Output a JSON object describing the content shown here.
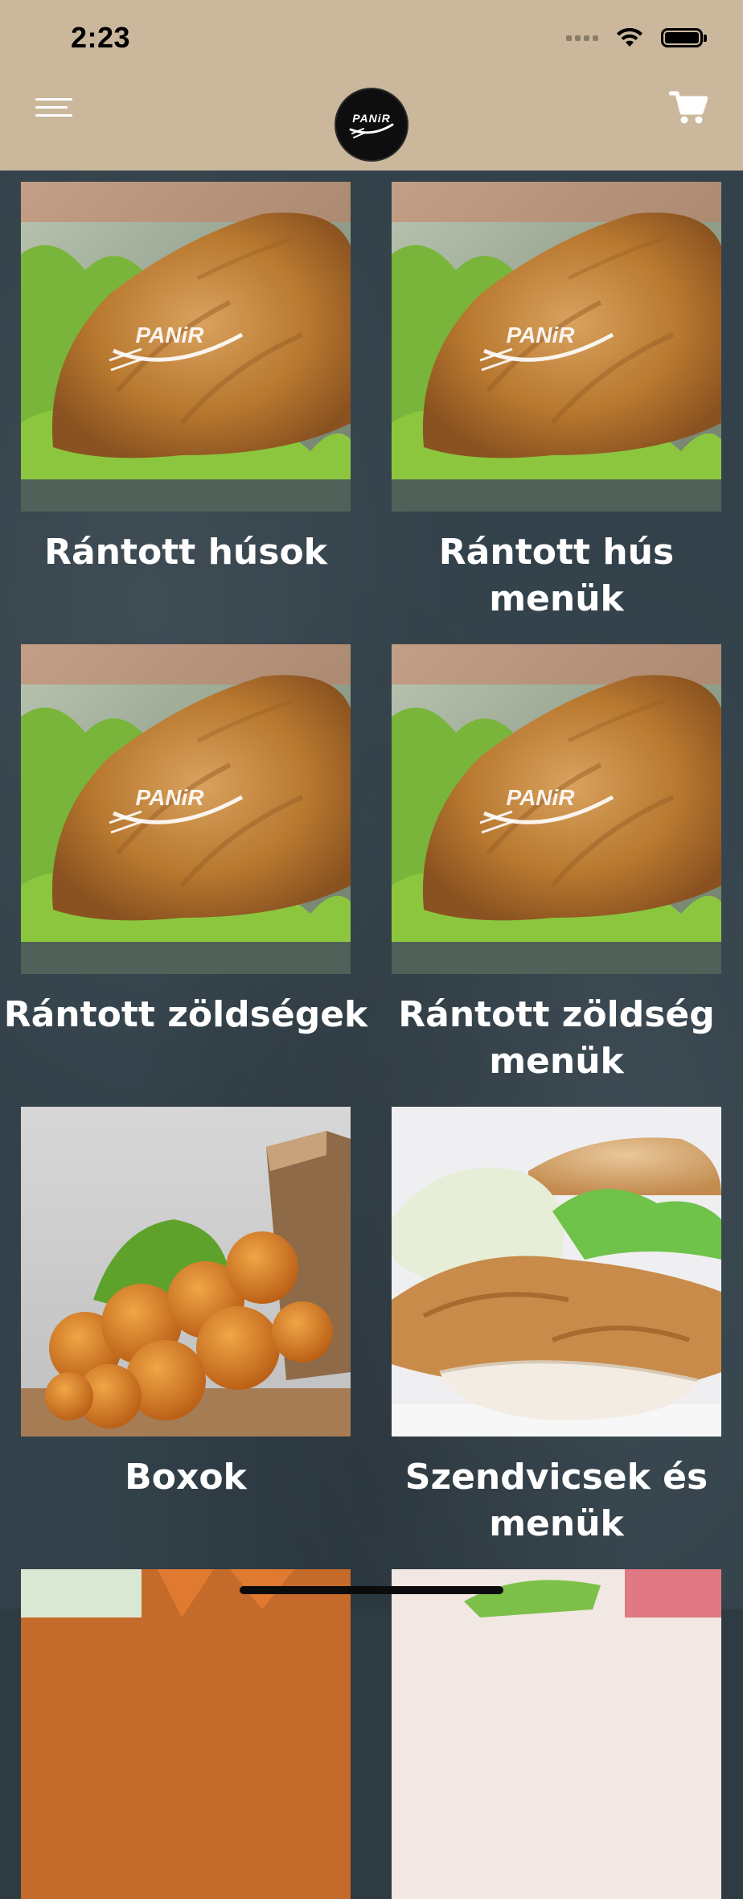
{
  "status_bar": {
    "time": "2:23"
  },
  "header": {
    "menu_icon": "hamburger-menu-icon",
    "logo_text": "PANiR",
    "cart_icon": "shopping-cart-icon"
  },
  "categories": [
    {
      "label": "Rántott húsok",
      "image": "fried-meat-photo"
    },
    {
      "label": "Rántott hús menük",
      "image": "fried-meat-photo"
    },
    {
      "label": "Rántott zöldségek",
      "image": "fried-meat-photo"
    },
    {
      "label": "Rántott zöldség menük",
      "image": "fried-meat-photo"
    },
    {
      "label": "Boxok",
      "image": "chicken-box-photo"
    },
    {
      "label": "Szendvicsek és menük",
      "image": "sandwich-photo"
    },
    {
      "label": "",
      "image": "partial-next-photo"
    },
    {
      "label": "",
      "image": "partial-next-photo"
    }
  ],
  "colors": {
    "header_bg": "#cbb89c",
    "page_bg": "#33414a",
    "text": "#ffffff"
  }
}
